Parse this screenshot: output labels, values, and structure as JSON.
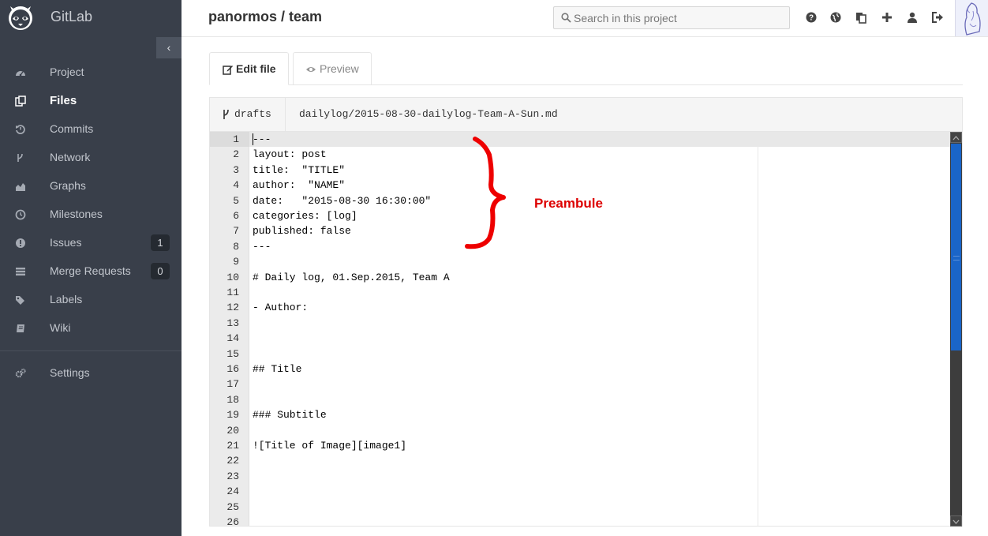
{
  "app": {
    "name": "GitLab"
  },
  "sidebar": {
    "collapse_glyph": "‹",
    "items": [
      {
        "label": "Project",
        "icon": "dashboard-icon",
        "active": false
      },
      {
        "label": "Files",
        "icon": "files-icon",
        "active": true
      },
      {
        "label": "Commits",
        "icon": "history-icon",
        "active": false
      },
      {
        "label": "Network",
        "icon": "code-fork-icon",
        "active": false
      },
      {
        "label": "Graphs",
        "icon": "area-chart-icon",
        "active": false
      },
      {
        "label": "Milestones",
        "icon": "clock-icon",
        "active": false
      },
      {
        "label": "Issues",
        "icon": "exclamation-circle-icon",
        "active": false,
        "badge": "1"
      },
      {
        "label": "Merge Requests",
        "icon": "list-icon",
        "active": false,
        "badge": "0"
      },
      {
        "label": "Labels",
        "icon": "tags-icon",
        "active": false
      },
      {
        "label": "Wiki",
        "icon": "book-icon",
        "active": false
      }
    ],
    "settings": {
      "label": "Settings",
      "icon": "cogs-icon"
    }
  },
  "header": {
    "title": "panormos / team",
    "search": {
      "placeholder": "Search in this project",
      "value": ""
    },
    "icons": [
      "help-icon",
      "globe-icon",
      "snippets-icon",
      "plus-icon",
      "user-icon",
      "sign-out-icon"
    ]
  },
  "tabs": {
    "edit": "Edit file",
    "preview": "Preview"
  },
  "file": {
    "branch": "drafts",
    "path": "dailylog/2015-08-30-dailylog-Team-A-Sun.md"
  },
  "editor": {
    "lines": [
      "---",
      "layout: post",
      "title:  \"TITLE\"",
      "author:  \"NAME\"",
      "date:   \"2015-08-30 16:30:00\"",
      "categories: [log]",
      "published: false",
      "---",
      "",
      "# Daily log, 01.Sep.2015, Team A",
      "",
      "- Author:",
      "",
      "",
      "",
      "## Title",
      "",
      "",
      "### Subtitle",
      "",
      "![Title of Image][image1]",
      "",
      "",
      "",
      "",
      ""
    ]
  },
  "annotation": {
    "label": "Preambule",
    "color": "#dd0000"
  },
  "colors": {
    "sidebar_bg": "#393f4a",
    "scroll_thumb": "#1a65c8"
  }
}
